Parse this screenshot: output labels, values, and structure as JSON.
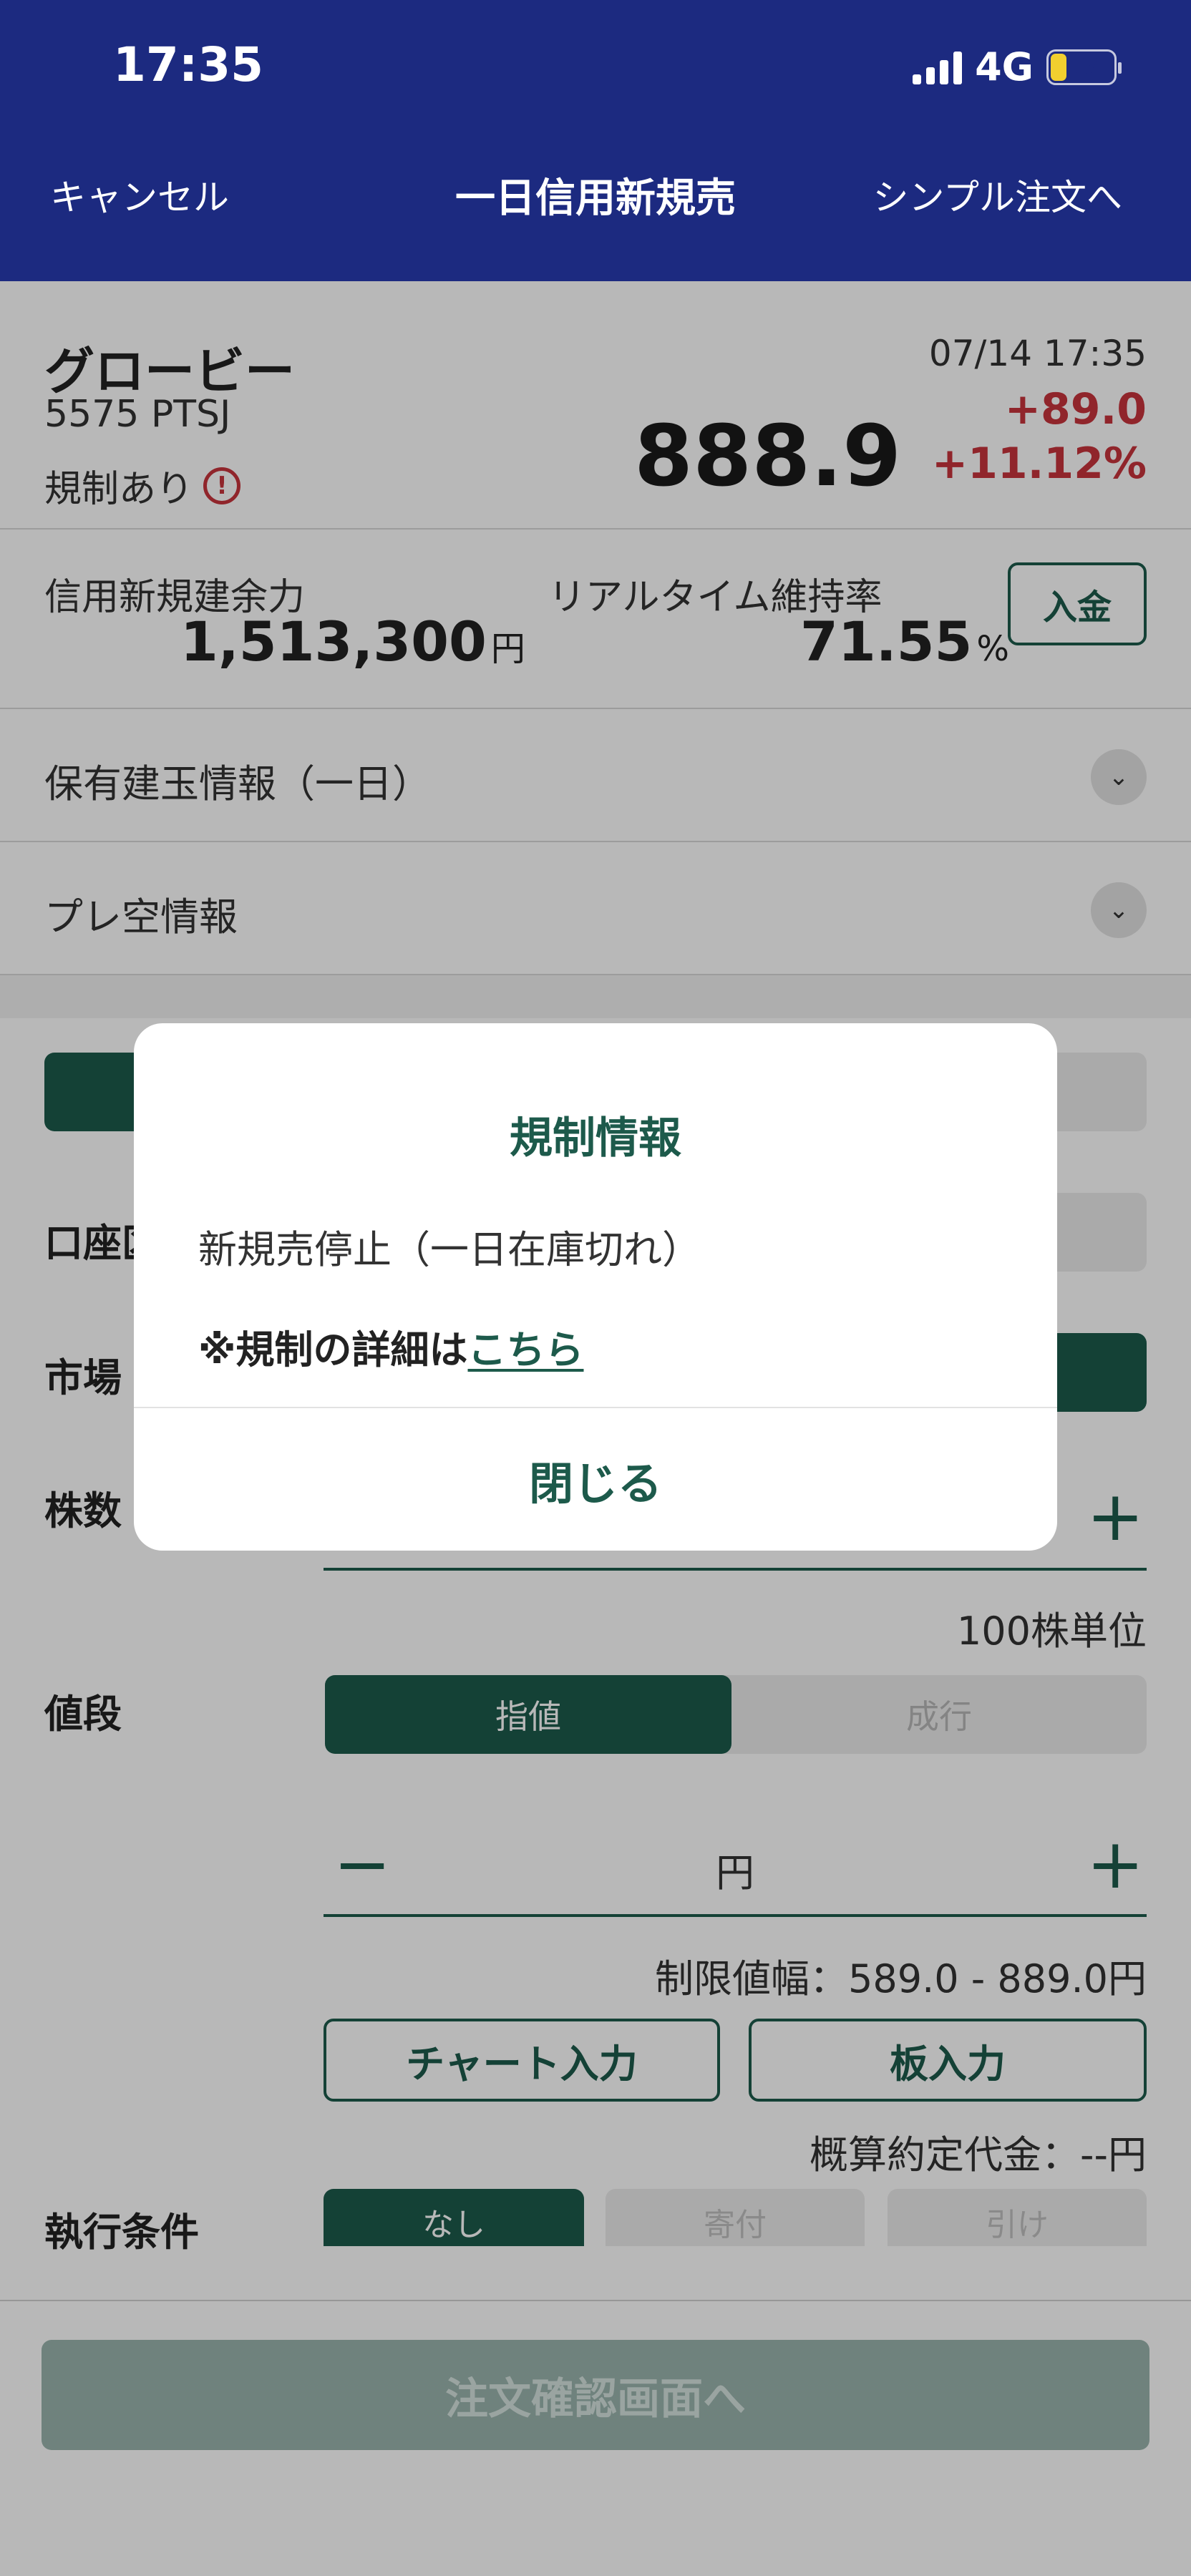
{
  "status_bar": {
    "time": "17:35",
    "network": "4G",
    "battery": "17"
  },
  "nav": {
    "cancel": "キャンセル",
    "title": "一日信用新規売",
    "simple_order": "シンプル注文へ"
  },
  "stock": {
    "name": "グロービー",
    "code_market": "5575  PTSJ",
    "regulation": "規制あり",
    "datetime": "07/14 17:35",
    "price": "888.9",
    "change": "+89.0",
    "change_pct": "+11.12%"
  },
  "balance": {
    "credit_label": "信用新規建余力",
    "credit_value": "1,513,300",
    "yen": "円",
    "ratio_label": "リアルタイム維持率",
    "ratio_value": "71.55",
    "percent": "%",
    "deposit_button": "入金"
  },
  "sections": {
    "positions": "保有建玉情報（一日）",
    "preshort": "プレ空情報"
  },
  "form": {
    "account_label": "口座区",
    "market_label": "市場",
    "shares_label": "株数",
    "unit_note": "100株単位",
    "price_label": "値段",
    "limit_order": "指値",
    "market_order": "成行",
    "yen": "円",
    "price_range": "制限値幅：589.0 - 889.0円",
    "chart_input": "チャート入力",
    "board_input": "板入力",
    "estimate": "概算約定代金：--円",
    "exec_label": "執行条件",
    "exec_options": [
      "なし",
      "寄付",
      "引け"
    ]
  },
  "confirm_button": "注文確認画面へ",
  "modal": {
    "title": "規制情報",
    "body": "新規売停止（一日在庫切れ）",
    "note_prefix": "※規制の詳細は",
    "note_link": "こちら",
    "close": "閉じる"
  },
  "colors": {
    "header": "#1c2a80",
    "accent": "#1d5a4b",
    "negative": "#c8343c"
  }
}
